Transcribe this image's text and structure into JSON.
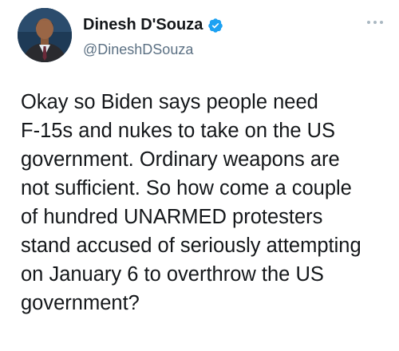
{
  "tweet": {
    "author": {
      "display_name": "Dinesh D'Souza",
      "handle": "@DineshDSouza",
      "verified": true,
      "avatar_icon": "avatar-photo"
    },
    "more_icon": "more-options-icon",
    "text_lines": [
      "Okay so Biden says people need",
      "F-15s and nukes to take on the US",
      "government. Ordinary weapons are",
      "not sufficient. So how come a couple",
      "of hundred UNARMED protesters",
      "stand accused of seriously attempting",
      "on January 6 to overthrow the US",
      "government?"
    ]
  },
  "colors": {
    "text": "#14171a",
    "secondary": "#5b7083",
    "verified_badge": "#1da1f2",
    "background": "#ffffff"
  }
}
